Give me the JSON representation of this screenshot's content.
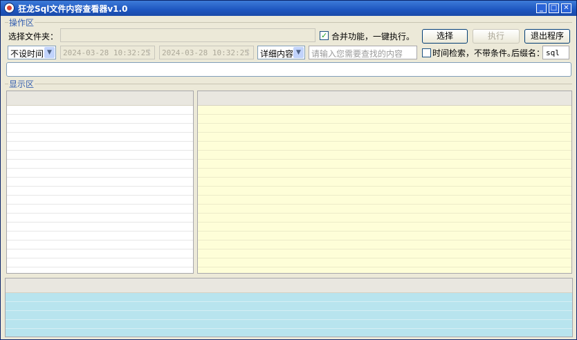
{
  "window": {
    "title": "狂龙Sql文件内容查看器v1.0",
    "controls": {
      "minimize": "_",
      "maximize": "□",
      "close": "✕"
    }
  },
  "ops": {
    "group_label": "操作区",
    "folder_label": "选择文件夹：",
    "folder_value": "",
    "merge_checked": true,
    "merge_label": "合并功能，一键执行。",
    "select_button": "选择",
    "run_button": "执行",
    "exit_button": "退出程序",
    "time_mode": "不设时间",
    "start_time": "2024-03-28 10:32:25",
    "end_time": "2024-03-28 10:32:25",
    "content_mode": "详细内容",
    "search_placeholder": "请输入您需要查找的内容",
    "time_search_checked": false,
    "time_search_label": "时间检索，不带条件。",
    "suffix_label": "后缀名：",
    "suffix_value": "sql",
    "status_value": ""
  },
  "display": {
    "group_label": "显示区"
  },
  "colors": {
    "titlebar": "#1e56c0",
    "window_bg": "#ece9d8",
    "content_bg": "#fefed8",
    "log_bg": "#b8e4ee",
    "group_label": "#3660b0"
  }
}
